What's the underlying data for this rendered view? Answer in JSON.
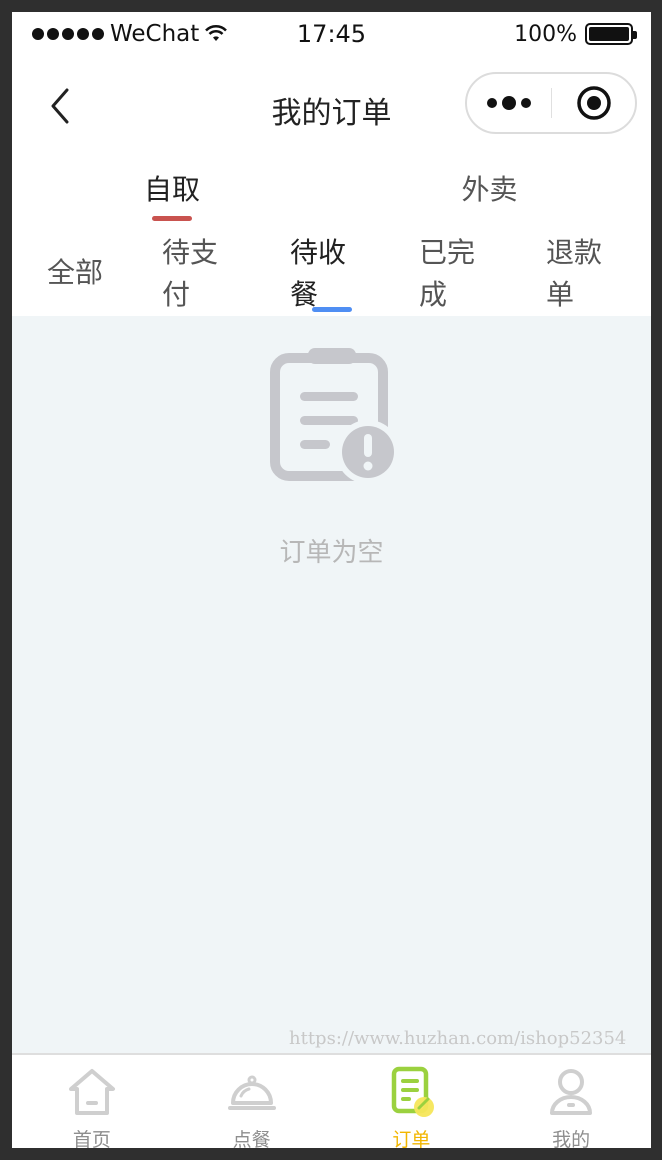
{
  "status_bar": {
    "carrier": "WeChat",
    "time": "17:45",
    "battery": "100%"
  },
  "nav": {
    "title": "我的订单"
  },
  "top_tabs": [
    {
      "label": "自取",
      "active": true
    },
    {
      "label": "外卖",
      "active": false
    }
  ],
  "sub_tabs": [
    {
      "label": "全部",
      "active": false
    },
    {
      "label": "待支付",
      "active": false
    },
    {
      "label": "待收餐",
      "active": true
    },
    {
      "label": "已完成",
      "active": false
    },
    {
      "label": "退款单",
      "active": false
    }
  ],
  "content": {
    "empty_text": "订单为空",
    "watermark": "https://www.huzhan.com/ishop52354"
  },
  "tab_bar": [
    {
      "label": "首页",
      "icon": "home-icon",
      "active": false
    },
    {
      "label": "点餐",
      "icon": "food-cover-icon",
      "active": false
    },
    {
      "label": "订单",
      "icon": "order-icon",
      "active": true
    },
    {
      "label": "我的",
      "icon": "user-icon",
      "active": false
    }
  ],
  "colors": {
    "top_tab_indicator": "#c9534f",
    "sub_tab_indicator": "#4f8ef3",
    "content_bg": "#f0f5f7",
    "active_tab_label": "#f2b600",
    "order_icon_green": "#9bd13f",
    "order_icon_yellow": "#f5e65a"
  }
}
